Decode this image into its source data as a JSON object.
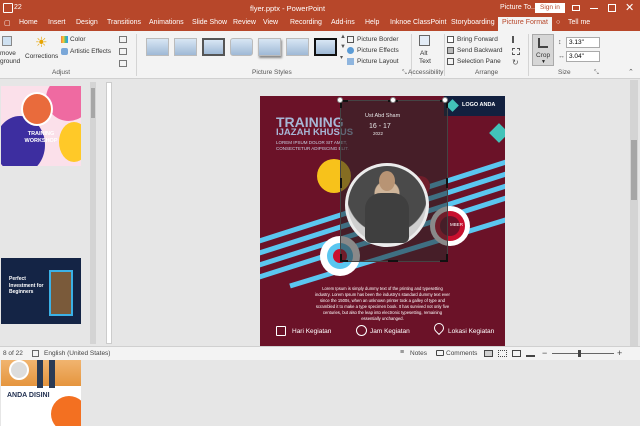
{
  "window": {
    "title": "flyer.pptx  -  PowerPoint",
    "context_label": "Picture To...",
    "signin": "Sign in",
    "quick_access_count": "22"
  },
  "tabs": [
    "Home",
    "Insert",
    "Design",
    "Transitions",
    "Animations",
    "Slide Show",
    "Review",
    "View",
    "Recording",
    "Add-ins",
    "Help",
    "Inknoe ClassPoint",
    "Storyboarding",
    "Picture Format"
  ],
  "active_tab": "Picture Format",
  "tell_me": "Tell me",
  "ribbon": {
    "remove_bg_line1": "move",
    "remove_bg_line2": "ground",
    "corrections": "Corrections",
    "color": "Color",
    "artistic_effects": "Artistic Effects",
    "adjust_label": "Adjust",
    "picture_border": "Picture Border",
    "picture_effects": "Picture Effects",
    "picture_layout": "Picture Layout",
    "picture_styles_label": "Picture Styles",
    "alt_text_line1": "Alt",
    "alt_text_line2": "Text",
    "accessibility_label": "Accessibility",
    "bring_forward": "Bring Forward",
    "send_backward": "Send Backward",
    "selection_pane": "Selection Pane",
    "arrange_label": "Arrange",
    "crop": "Crop",
    "height": "3.13\"",
    "width": "3.04\"",
    "size_label": "Size"
  },
  "thumbnails": [
    {
      "number": "",
      "title": "TRAINING WORKSHOP"
    },
    {
      "number": "",
      "title": "Perfect Investment for Beginners"
    },
    {
      "number": "",
      "title": "ANDA DISINI"
    }
  ],
  "slide": {
    "logo": "LOGO ANDA",
    "title_line1": "TRAINING",
    "title_line2": "IJAZAH KHUSUS",
    "subtitle_line1": "LOREM IPSUM DOLOR SIT AMET,",
    "subtitle_line2": "CONSECTETUR ADIPISCING ELIT.",
    "speaker_name": "Ust Abd Sham",
    "date_text": "16 - 17",
    "year_text": "2022",
    "member_text": "MBER",
    "body_line1": "Lorem Ipsum is simply dummy text of the printing and typesetting",
    "body_line2": "industry. Lorem Ipsum has been the industry's standard dummy text ever",
    "body_line3": "since the 1500s, when an unknown printer took a galley of type and",
    "body_line4": "scrambled it to make a type specimen book. It has survived not only five",
    "body_line5": "centuries, but also the leap into electronic typesetting, remaining",
    "body_line6": "essentially unchanged.",
    "footer_item1": "Hari Kegiatan",
    "footer_item2": "Jam Kegiatan",
    "footer_item3": "Lokasi Kegiatan"
  },
  "status": {
    "slide_counter": "8 of 22",
    "language": "English (United States)",
    "notes": "Notes",
    "comments": "Comments"
  },
  "colors": {
    "brand": "#b7472a",
    "slide_bg": "#6b1228",
    "accent_blue": "#5bc6f0",
    "accent_yellow": "#f7c21b",
    "accent_red": "#c8102e"
  }
}
